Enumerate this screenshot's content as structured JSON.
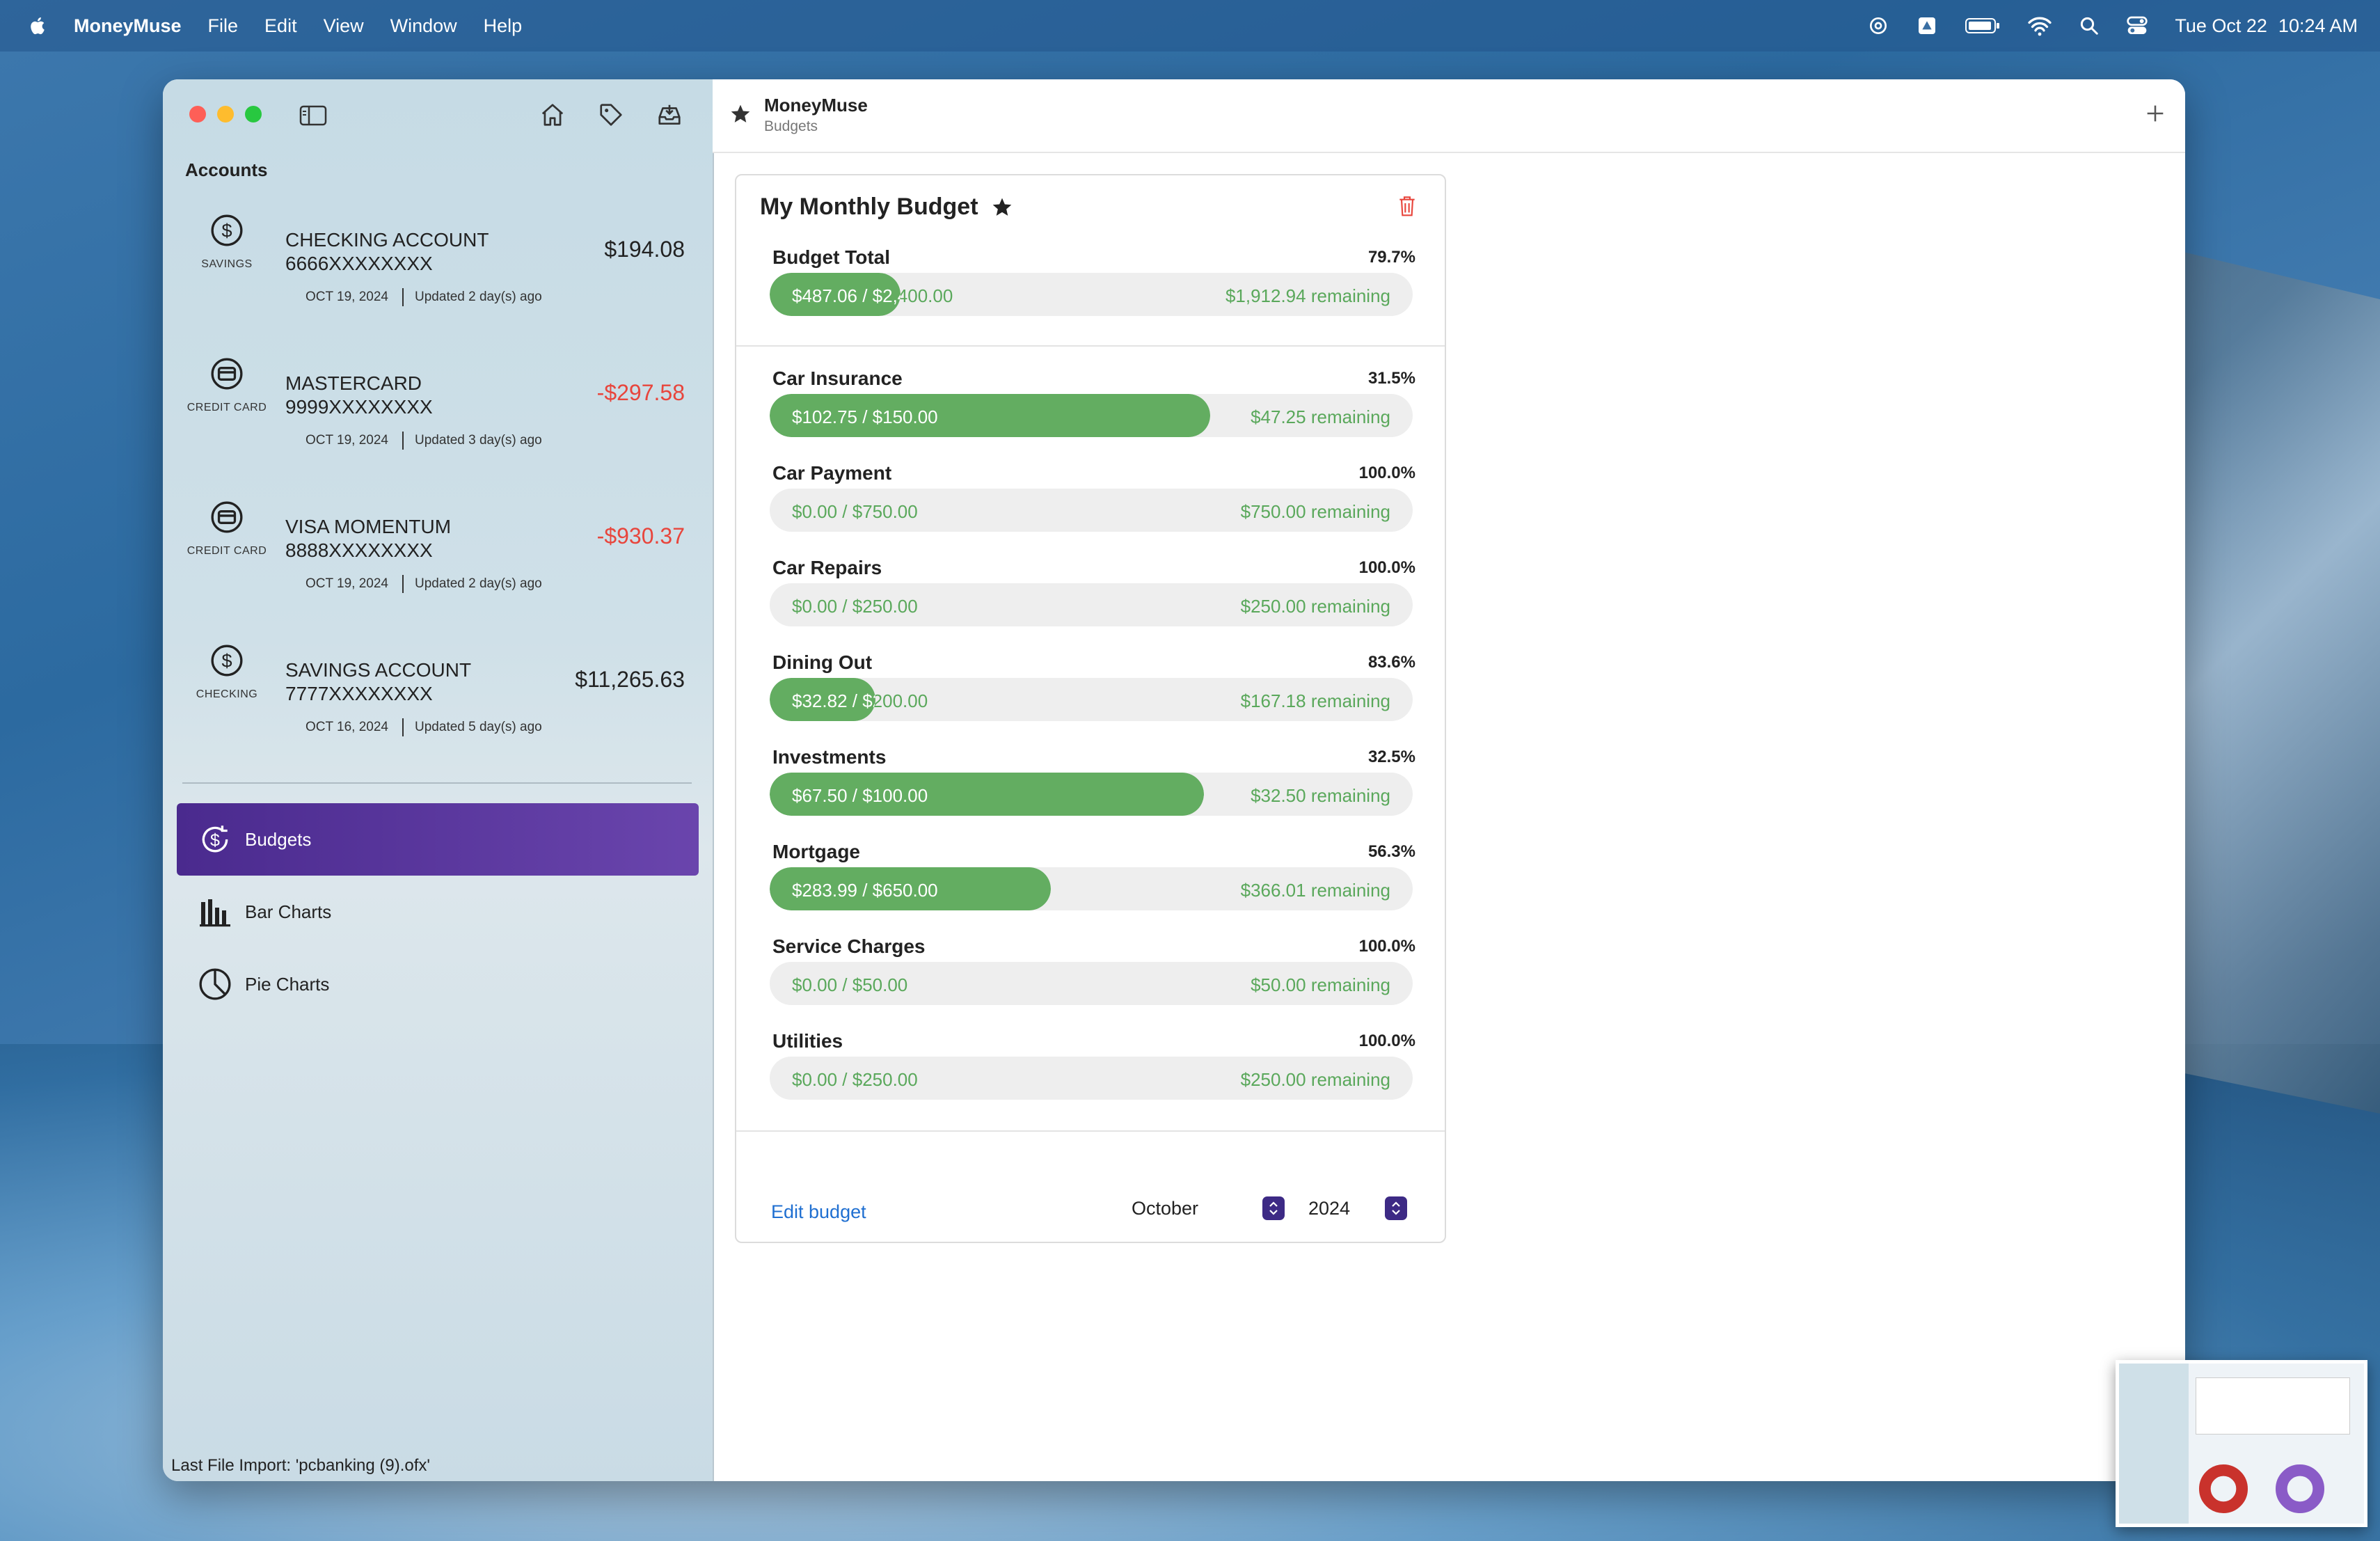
{
  "menubar": {
    "app_name": "MoneyMuse",
    "menus": [
      "File",
      "Edit",
      "View",
      "Window",
      "Help"
    ],
    "date": "Tue Oct 22",
    "time": "10:24 AM"
  },
  "sidebar": {
    "accounts_title": "Accounts",
    "accounts": [
      {
        "icon": "dollar-circle-icon",
        "type": "SAVINGS",
        "name": "CHECKING ACCOUNT",
        "number": "6666XXXXXXXX",
        "balance": "$194.08",
        "date": "OCT 19, 2024",
        "updated": "Updated 2 day(s) ago",
        "negative": false
      },
      {
        "icon": "credit-card-icon",
        "type": "CREDIT CARD",
        "name": "MASTERCARD",
        "number": "9999XXXXXXXX",
        "balance": "-$297.58",
        "date": "OCT 19, 2024",
        "updated": "Updated 3 day(s) ago",
        "negative": true
      },
      {
        "icon": "credit-card-icon",
        "type": "CREDIT CARD",
        "name": "VISA MOMENTUM",
        "number": "8888XXXXXXXX",
        "balance": "-$930.37",
        "date": "OCT 19, 2024",
        "updated": "Updated 2 day(s) ago",
        "negative": true
      },
      {
        "icon": "dollar-circle-icon",
        "type": "CHECKING",
        "name": "SAVINGS ACCOUNT",
        "number": "7777XXXXXXXX",
        "balance": "$11,265.63",
        "date": "OCT 16, 2024",
        "updated": "Updated 5 day(s) ago",
        "negative": false
      }
    ],
    "nav": [
      {
        "label": "Budgets",
        "icon": "budget-refresh-icon",
        "active": true
      },
      {
        "label": "Bar Charts",
        "icon": "bar-chart-icon",
        "active": false
      },
      {
        "label": "Pie Charts",
        "icon": "pie-chart-icon",
        "active": false
      }
    ],
    "last_import": "Last File Import: 'pcbanking (9).ofx'"
  },
  "toolbar": {
    "title": "MoneyMuse",
    "subtitle": "Budgets"
  },
  "budget": {
    "title": "My Monthly Budget",
    "total": {
      "name": "Budget Total",
      "percent": "79.7%",
      "amount": "$487.06 / $2,400.00",
      "remaining": "$1,912.94 remaining",
      "fill": 0.203
    },
    "categories": [
      {
        "name": "Car Insurance",
        "percent": "31.5%",
        "amount": "$102.75 / $150.00",
        "remaining": "$47.25 remaining",
        "fill": 0.685
      },
      {
        "name": "Car Payment",
        "percent": "100.0%",
        "amount": "$0.00 / $750.00",
        "remaining": "$750.00 remaining",
        "fill": 0
      },
      {
        "name": "Car Repairs",
        "percent": "100.0%",
        "amount": "$0.00 / $250.00",
        "remaining": "$250.00 remaining",
        "fill": 0
      },
      {
        "name": "Dining Out",
        "percent": "83.6%",
        "amount": "$32.82 / $200.00",
        "remaining": "$167.18 remaining",
        "fill": 0.164
      },
      {
        "name": "Investments",
        "percent": "32.5%",
        "amount": "$67.50 / $100.00",
        "remaining": "$32.50 remaining",
        "fill": 0.675
      },
      {
        "name": "Mortgage",
        "percent": "56.3%",
        "amount": "$283.99 / $650.00",
        "remaining": "$366.01 remaining",
        "fill": 0.437
      },
      {
        "name": "Service Charges",
        "percent": "100.0%",
        "amount": "$0.00 / $50.00",
        "remaining": "$50.00 remaining",
        "fill": 0
      },
      {
        "name": "Utilities",
        "percent": "100.0%",
        "amount": "$0.00 / $250.00",
        "remaining": "$250.00 remaining",
        "fill": 0
      }
    ],
    "edit_label": "Edit budget",
    "month": "October",
    "year": "2024"
  },
  "colors": {
    "accent_purple": "#4a2a8e",
    "progress_green": "#63ad61",
    "negative_red": "#e8453c",
    "link_blue": "#1f6fd1"
  }
}
